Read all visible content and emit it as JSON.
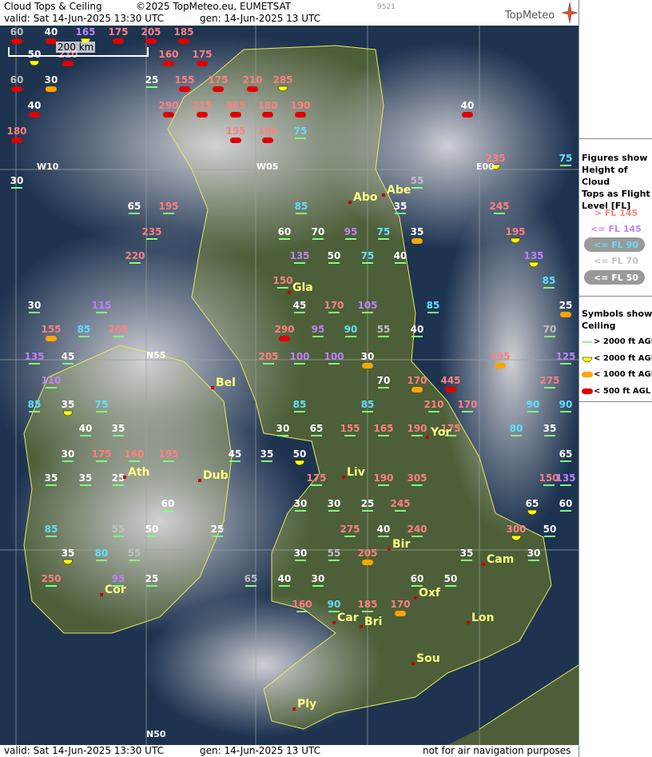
{
  "header": {
    "title": "Cloud Tops & Ceiling",
    "copyright": "©2025 TopMeteo.eu, EUMETSAT",
    "valid": "valid:  Sat  14-Jun-2025  13:30 UTC",
    "generated": "gen: 14-Jun-2025 13 UTC",
    "code": "9521",
    "logo_text": "TopMeteo"
  },
  "scale_bar": {
    "label": "200 km"
  },
  "grid_labels": [
    "W10",
    "W05",
    "E00",
    "N55",
    "N50"
  ],
  "cities": [
    "Abo",
    "Abe",
    "Gla",
    "Bel",
    "Yor",
    "Ath",
    "Dub",
    "Liv",
    "Bir",
    "Cam",
    "Cor",
    "Oxf",
    "Car",
    "Bri",
    "Lon",
    "Sou",
    "Ply"
  ],
  "legend": {
    "figures_title": "Figures show\nHeight of Cloud\nTops as Flight\nLevel  [FL]",
    "fl_rows": [
      {
        "label": "> FL 145",
        "color": "#ff8080",
        "pill": false
      },
      {
        "label": "<= FL 145",
        "color": "#c080ff",
        "pill": false
      },
      {
        "label": "<= FL 90",
        "color": "#60e0ff",
        "pill": true
      },
      {
        "label": "<= FL 70",
        "color": "#c0c0c0",
        "pill": false
      },
      {
        "label": "<= FL 50",
        "color": "#ffffff",
        "pill": true
      }
    ],
    "symbols_title": "Symbols show\nCeiling",
    "symbol_rows": [
      {
        "label": "> 2000 ft AGL",
        "kind": "line",
        "color": "#80ff80"
      },
      {
        "label": "< 2000 ft AGL",
        "kind": "half",
        "color": "#ffff00"
      },
      {
        "label": "< 1000 ft AGL",
        "kind": "pill",
        "color": "#ffa500"
      },
      {
        "label": "< 500 ft AGL",
        "kind": "pill",
        "color": "#e00000"
      }
    ]
  },
  "footer": {
    "valid": "valid:  Sat  14-Jun-2025  13:30 UTC",
    "generated": "gen: 14-Jun-2025 13 UTC",
    "disclaimer": "not for air navigation purposes"
  },
  "colors": {
    "sea": "#1d3350",
    "land": "#4c5f38",
    "cloud": "#c8c8cc",
    "grid": "#a0a0a0",
    "coast": "#e8e860",
    "high": "#ff8080",
    "mid": "#c080ff",
    "low": "#60e0ff",
    "lower": "#c0c0c0",
    "lowest": "#ffffff"
  },
  "observations": [
    {
      "v": "60",
      "c": "gray",
      "s": "red"
    },
    {
      "v": "40",
      "c": "white",
      "s": "red"
    },
    {
      "v": "165",
      "c": "purple",
      "s": "yellow"
    },
    {
      "v": "175",
      "c": "pink",
      "s": "red"
    },
    {
      "v": "205",
      "c": "pink",
      "s": "red"
    },
    {
      "v": "185",
      "c": "pink",
      "s": "red"
    },
    {
      "v": "50",
      "c": "white",
      "s": "yellow"
    },
    {
      "v": "210",
      "c": "pink",
      "s": "red"
    },
    {
      "v": "160",
      "c": "pink",
      "s": "red"
    },
    {
      "v": "175",
      "c": "pink",
      "s": "red"
    },
    {
      "v": "60",
      "c": "gray",
      "s": "red"
    },
    {
      "v": "30",
      "c": "white",
      "s": "orange"
    },
    {
      "v": "25",
      "c": "white",
      "s": "green"
    },
    {
      "v": "155",
      "c": "pink",
      "s": "red"
    },
    {
      "v": "175",
      "c": "pink",
      "s": "red"
    },
    {
      "v": "210",
      "c": "pink",
      "s": "red"
    },
    {
      "v": "285",
      "c": "pink",
      "s": "yellow"
    },
    {
      "v": "40",
      "c": "white",
      "s": "red"
    },
    {
      "v": "290",
      "c": "pink",
      "s": "red"
    },
    {
      "v": "215",
      "c": "pink",
      "s": "red"
    },
    {
      "v": "365",
      "c": "pink",
      "s": "red"
    },
    {
      "v": "180",
      "c": "pink",
      "s": "red"
    },
    {
      "v": "190",
      "c": "pink",
      "s": "red"
    },
    {
      "v": "40",
      "c": "white",
      "s": "red"
    },
    {
      "v": "180",
      "c": "pink",
      "s": "red"
    },
    {
      "v": "195",
      "c": "pink",
      "s": "red"
    },
    {
      "v": "180",
      "c": "pink",
      "s": "red"
    },
    {
      "v": "75",
      "c": "cyan",
      "s": "green"
    },
    {
      "v": "235",
      "c": "pink",
      "s": "yellow"
    },
    {
      "v": "75",
      "c": "cyan",
      "s": "green"
    },
    {
      "v": "30",
      "c": "white",
      "s": "green"
    },
    {
      "v": "55",
      "c": "gray",
      "s": "green"
    },
    {
      "v": "65",
      "c": "white",
      "s": "green"
    },
    {
      "v": "195",
      "c": "pink",
      "s": "green"
    },
    {
      "v": "85",
      "c": "cyan",
      "s": "green"
    },
    {
      "v": "35",
      "c": "white",
      "s": "green"
    },
    {
      "v": "245",
      "c": "pink",
      "s": "green"
    },
    {
      "v": "235",
      "c": "pink",
      "s": "green"
    },
    {
      "v": "60",
      "c": "white",
      "s": "green"
    },
    {
      "v": "70",
      "c": "white",
      "s": "green"
    },
    {
      "v": "95",
      "c": "purple",
      "s": "green"
    },
    {
      "v": "75",
      "c": "cyan",
      "s": "green"
    },
    {
      "v": "35",
      "c": "white",
      "s": "orange"
    },
    {
      "v": "195",
      "c": "pink",
      "s": "yellow"
    },
    {
      "v": "220",
      "c": "pink",
      "s": "green"
    },
    {
      "v": "135",
      "c": "purple",
      "s": "green"
    },
    {
      "v": "50",
      "c": "white",
      "s": "green"
    },
    {
      "v": "75",
      "c": "cyan",
      "s": "green"
    },
    {
      "v": "40",
      "c": "white",
      "s": "green"
    },
    {
      "v": "135",
      "c": "purple",
      "s": "yellow"
    },
    {
      "v": "150",
      "c": "pink",
      "s": "green"
    },
    {
      "v": "85",
      "c": "cyan",
      "s": "green"
    },
    {
      "v": "30",
      "c": "white",
      "s": "green"
    },
    {
      "v": "115",
      "c": "purple",
      "s": "green"
    },
    {
      "v": "45",
      "c": "white",
      "s": "green"
    },
    {
      "v": "170",
      "c": "pink",
      "s": "green"
    },
    {
      "v": "105",
      "c": "purple",
      "s": "green"
    },
    {
      "v": "85",
      "c": "cyan",
      "s": "green"
    },
    {
      "v": "25",
      "c": "white",
      "s": "orange"
    },
    {
      "v": "155",
      "c": "pink",
      "s": "orange"
    },
    {
      "v": "85",
      "c": "cyan",
      "s": "green"
    },
    {
      "v": "205",
      "c": "pink",
      "s": "green"
    },
    {
      "v": "290",
      "c": "pink",
      "s": "red"
    },
    {
      "v": "95",
      "c": "purple",
      "s": "green"
    },
    {
      "v": "90",
      "c": "cyan",
      "s": "green"
    },
    {
      "v": "55",
      "c": "gray",
      "s": "green"
    },
    {
      "v": "40",
      "c": "white",
      "s": "green"
    },
    {
      "v": "70",
      "c": "gray",
      "s": "green"
    },
    {
      "v": "135",
      "c": "purple",
      "s": "green"
    },
    {
      "v": "45",
      "c": "white",
      "s": "green"
    },
    {
      "v": "205",
      "c": "pink",
      "s": "green"
    },
    {
      "v": "100",
      "c": "purple",
      "s": "green"
    },
    {
      "v": "100",
      "c": "purple",
      "s": "green"
    },
    {
      "v": "30",
      "c": "white",
      "s": "orange"
    },
    {
      "v": "195",
      "c": "pink",
      "s": "orange"
    },
    {
      "v": "125",
      "c": "purple",
      "s": "green"
    },
    {
      "v": "110",
      "c": "purple",
      "s": "green"
    },
    {
      "v": "70",
      "c": "white",
      "s": "green"
    },
    {
      "v": "170",
      "c": "pink",
      "s": "orange"
    },
    {
      "v": "445",
      "c": "pink",
      "s": "red"
    },
    {
      "v": "275",
      "c": "pink",
      "s": "green"
    },
    {
      "v": "85",
      "c": "cyan",
      "s": "green"
    },
    {
      "v": "35",
      "c": "white",
      "s": "yellow"
    },
    {
      "v": "75",
      "c": "cyan",
      "s": "green"
    },
    {
      "v": "85",
      "c": "cyan",
      "s": "green"
    },
    {
      "v": "85",
      "c": "cyan",
      "s": "green"
    },
    {
      "v": "210",
      "c": "pink",
      "s": "green"
    },
    {
      "v": "170",
      "c": "pink",
      "s": "green"
    },
    {
      "v": "90",
      "c": "cyan",
      "s": "green"
    },
    {
      "v": "90",
      "c": "cyan",
      "s": "green"
    },
    {
      "v": "40",
      "c": "white",
      "s": "green"
    },
    {
      "v": "35",
      "c": "white",
      "s": "green"
    },
    {
      "v": "30",
      "c": "white",
      "s": "green"
    },
    {
      "v": "65",
      "c": "white",
      "s": "green"
    },
    {
      "v": "155",
      "c": "pink",
      "s": "green"
    },
    {
      "v": "165",
      "c": "pink",
      "s": "green"
    },
    {
      "v": "190",
      "c": "pink",
      "s": "green"
    },
    {
      "v": "175",
      "c": "pink",
      "s": "green"
    },
    {
      "v": "80",
      "c": "cyan",
      "s": "green"
    },
    {
      "v": "35",
      "c": "white",
      "s": "green"
    },
    {
      "v": "30",
      "c": "white",
      "s": "green"
    },
    {
      "v": "175",
      "c": "pink",
      "s": "green"
    },
    {
      "v": "160",
      "c": "pink",
      "s": "green"
    },
    {
      "v": "195",
      "c": "pink",
      "s": "green"
    },
    {
      "v": "45",
      "c": "white",
      "s": "green"
    },
    {
      "v": "35",
      "c": "white",
      "s": "green"
    },
    {
      "v": "50",
      "c": "white",
      "s": "yellow"
    },
    {
      "v": "65",
      "c": "white",
      "s": "green"
    },
    {
      "v": "35",
      "c": "white",
      "s": "green"
    },
    {
      "v": "35",
      "c": "white",
      "s": "green"
    },
    {
      "v": "25",
      "c": "white",
      "s": "green"
    },
    {
      "v": "175",
      "c": "pink",
      "s": "green"
    },
    {
      "v": "190",
      "c": "pink",
      "s": "green"
    },
    {
      "v": "305",
      "c": "pink",
      "s": "green"
    },
    {
      "v": "150",
      "c": "pink",
      "s": "green"
    },
    {
      "v": "135",
      "c": "purple",
      "s": "green"
    },
    {
      "v": "60",
      "c": "white",
      "s": "green"
    },
    {
      "v": "30",
      "c": "white",
      "s": "green"
    },
    {
      "v": "30",
      "c": "white",
      "s": "green"
    },
    {
      "v": "25",
      "c": "white",
      "s": "green"
    },
    {
      "v": "245",
      "c": "pink",
      "s": "green"
    },
    {
      "v": "65",
      "c": "white",
      "s": "yellow"
    },
    {
      "v": "60",
      "c": "white",
      "s": "green"
    },
    {
      "v": "85",
      "c": "cyan",
      "s": "green"
    },
    {
      "v": "55",
      "c": "gray",
      "s": "green"
    },
    {
      "v": "50",
      "c": "white",
      "s": "green"
    },
    {
      "v": "25",
      "c": "white",
      "s": "green"
    },
    {
      "v": "275",
      "c": "pink",
      "s": "green"
    },
    {
      "v": "40",
      "c": "white",
      "s": "green"
    },
    {
      "v": "240",
      "c": "pink",
      "s": "green"
    },
    {
      "v": "300",
      "c": "pink",
      "s": "yellow"
    },
    {
      "v": "50",
      "c": "white",
      "s": "green"
    },
    {
      "v": "35",
      "c": "white",
      "s": "yellow"
    },
    {
      "v": "80",
      "c": "cyan",
      "s": "green"
    },
    {
      "v": "55",
      "c": "gray",
      "s": "green"
    },
    {
      "v": "30",
      "c": "white",
      "s": "green"
    },
    {
      "v": "55",
      "c": "gray",
      "s": "green"
    },
    {
      "v": "205",
      "c": "pink",
      "s": "orange"
    },
    {
      "v": "35",
      "c": "white",
      "s": "green"
    },
    {
      "v": "30",
      "c": "white",
      "s": "green"
    },
    {
      "v": "250",
      "c": "pink",
      "s": "green"
    },
    {
      "v": "95",
      "c": "purple",
      "s": "green"
    },
    {
      "v": "25",
      "c": "white",
      "s": "green"
    },
    {
      "v": "65",
      "c": "gray",
      "s": "green"
    },
    {
      "v": "40",
      "c": "white",
      "s": "green"
    },
    {
      "v": "30",
      "c": "white",
      "s": "green"
    },
    {
      "v": "60",
      "c": "white",
      "s": "green"
    },
    {
      "v": "50",
      "c": "white",
      "s": "green"
    },
    {
      "v": "160",
      "c": "pink",
      "s": "green"
    },
    {
      "v": "90",
      "c": "cyan",
      "s": "green"
    },
    {
      "v": "185",
      "c": "pink",
      "s": "green"
    },
    {
      "v": "170",
      "c": "pink",
      "s": "orange"
    }
  ]
}
